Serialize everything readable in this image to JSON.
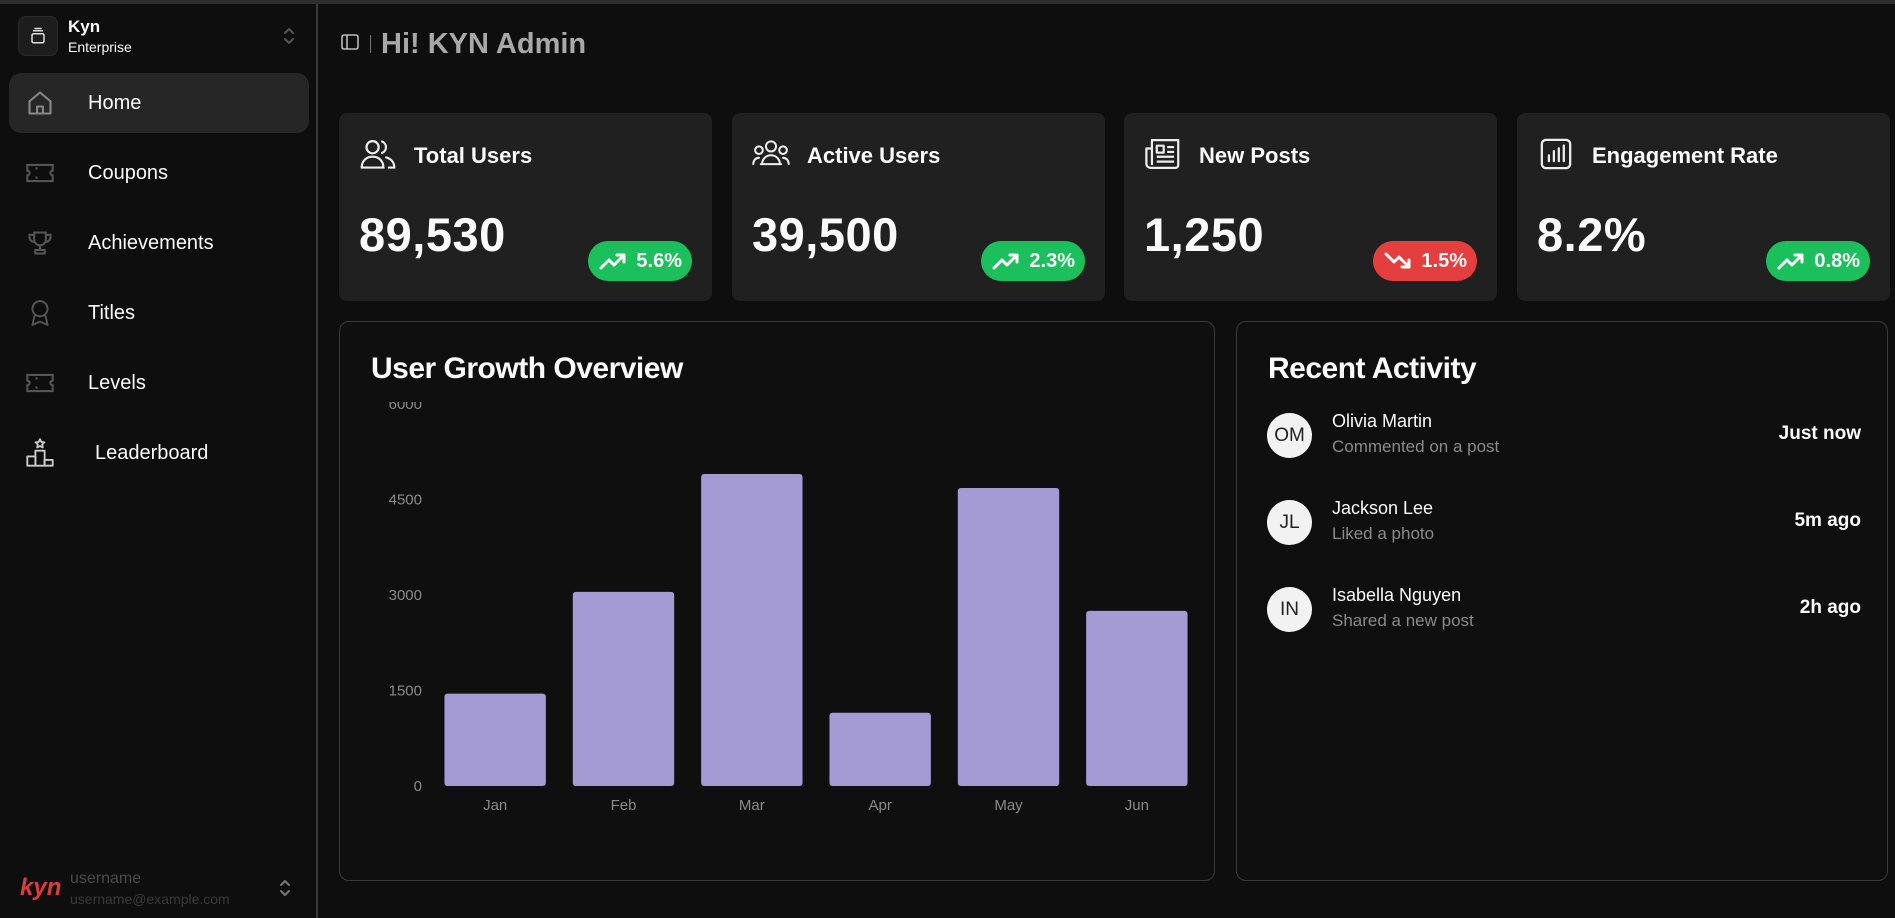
{
  "org": {
    "name": "Kyn",
    "plan": "Enterprise"
  },
  "nav": [
    {
      "label": "Home",
      "icon": "home-icon"
    },
    {
      "label": "Coupons",
      "icon": "ticket-icon"
    },
    {
      "label": "Achievements",
      "icon": "trophy-icon"
    },
    {
      "label": "Titles",
      "icon": "award-icon"
    },
    {
      "label": "Levels",
      "icon": "ticket-icon"
    },
    {
      "label": "Leaderboard",
      "icon": "podium-icon"
    }
  ],
  "user": {
    "brand": "kyn",
    "name": "username",
    "email": "username@example.com"
  },
  "header": {
    "title": "Hi! KYN Admin"
  },
  "stats": [
    {
      "title": "Total Users",
      "value": "89,530",
      "change": "5.6%",
      "trend": "up",
      "icon": "users-icon"
    },
    {
      "title": "Active Users",
      "value": "39,500",
      "change": "2.3%",
      "trend": "up",
      "icon": "group-icon"
    },
    {
      "title": "New Posts",
      "value": "1,250",
      "change": "1.5%",
      "trend": "down",
      "icon": "newspaper-icon"
    },
    {
      "title": "Engagement Rate",
      "value": "8.2%",
      "change": "0.8%",
      "trend": "up",
      "icon": "bar-chart-icon"
    }
  ],
  "growth": {
    "title": "User Growth Overview"
  },
  "chart_data": {
    "type": "bar",
    "title": "User Growth Overview",
    "categories": [
      "Jan",
      "Feb",
      "Mar",
      "Apr",
      "May",
      "Jun"
    ],
    "values": [
      1450,
      3050,
      4900,
      1150,
      4680,
      2750
    ],
    "yticks": [
      "0",
      "1500",
      "3000",
      "4500",
      "6000"
    ],
    "ylim": [
      0,
      6000
    ],
    "xlabel": "",
    "ylabel": "",
    "grid": false,
    "bar_color": "#a49bd4"
  },
  "activity": {
    "title": "Recent Activity",
    "items": [
      {
        "initials": "OM",
        "name": "Olivia Martin",
        "desc": "Commented on a post",
        "time": "Just now"
      },
      {
        "initials": "JL",
        "name": "Jackson Lee",
        "desc": "Liked a photo",
        "time": "5m ago"
      },
      {
        "initials": "IN",
        "name": "Isabella Nguyen",
        "desc": "Shared a new post",
        "time": "2h ago"
      }
    ]
  },
  "colors": {
    "up": "#1bbf5c",
    "down": "#e53e3e",
    "brand": "#e03b3b",
    "card": "#1f201f"
  }
}
